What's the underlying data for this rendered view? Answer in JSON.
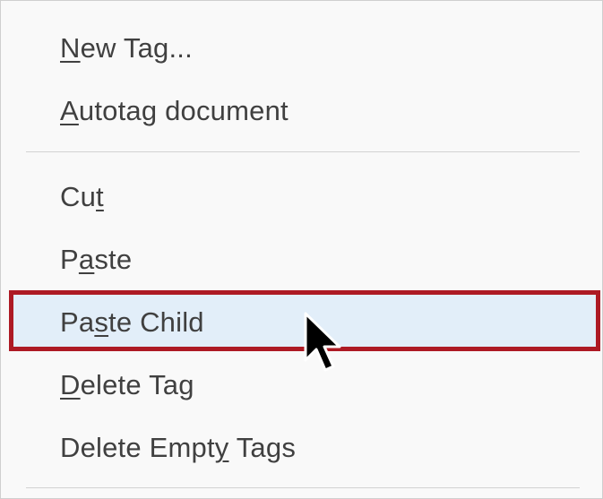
{
  "menu": {
    "items": [
      {
        "pre": "",
        "key": "N",
        "post": "ew Tag..."
      },
      {
        "pre": "",
        "key": "A",
        "post": "utotag document"
      },
      {
        "pre": "Cu",
        "key": "t",
        "post": ""
      },
      {
        "pre": "P",
        "key": "a",
        "post": "ste"
      },
      {
        "pre": "Pa",
        "key": "s",
        "post": "te Child"
      },
      {
        "pre": "",
        "key": "D",
        "post": "elete Tag"
      },
      {
        "pre": "Delete Empt",
        "key": "y",
        "post": " Tags"
      }
    ],
    "highlighted_item": "Paste Child"
  },
  "colors": {
    "highlight_border": "#ad1a24",
    "highlight_fill": "#e2eef9"
  },
  "cursor": {
    "icon": "arrow-pointer-icon"
  }
}
